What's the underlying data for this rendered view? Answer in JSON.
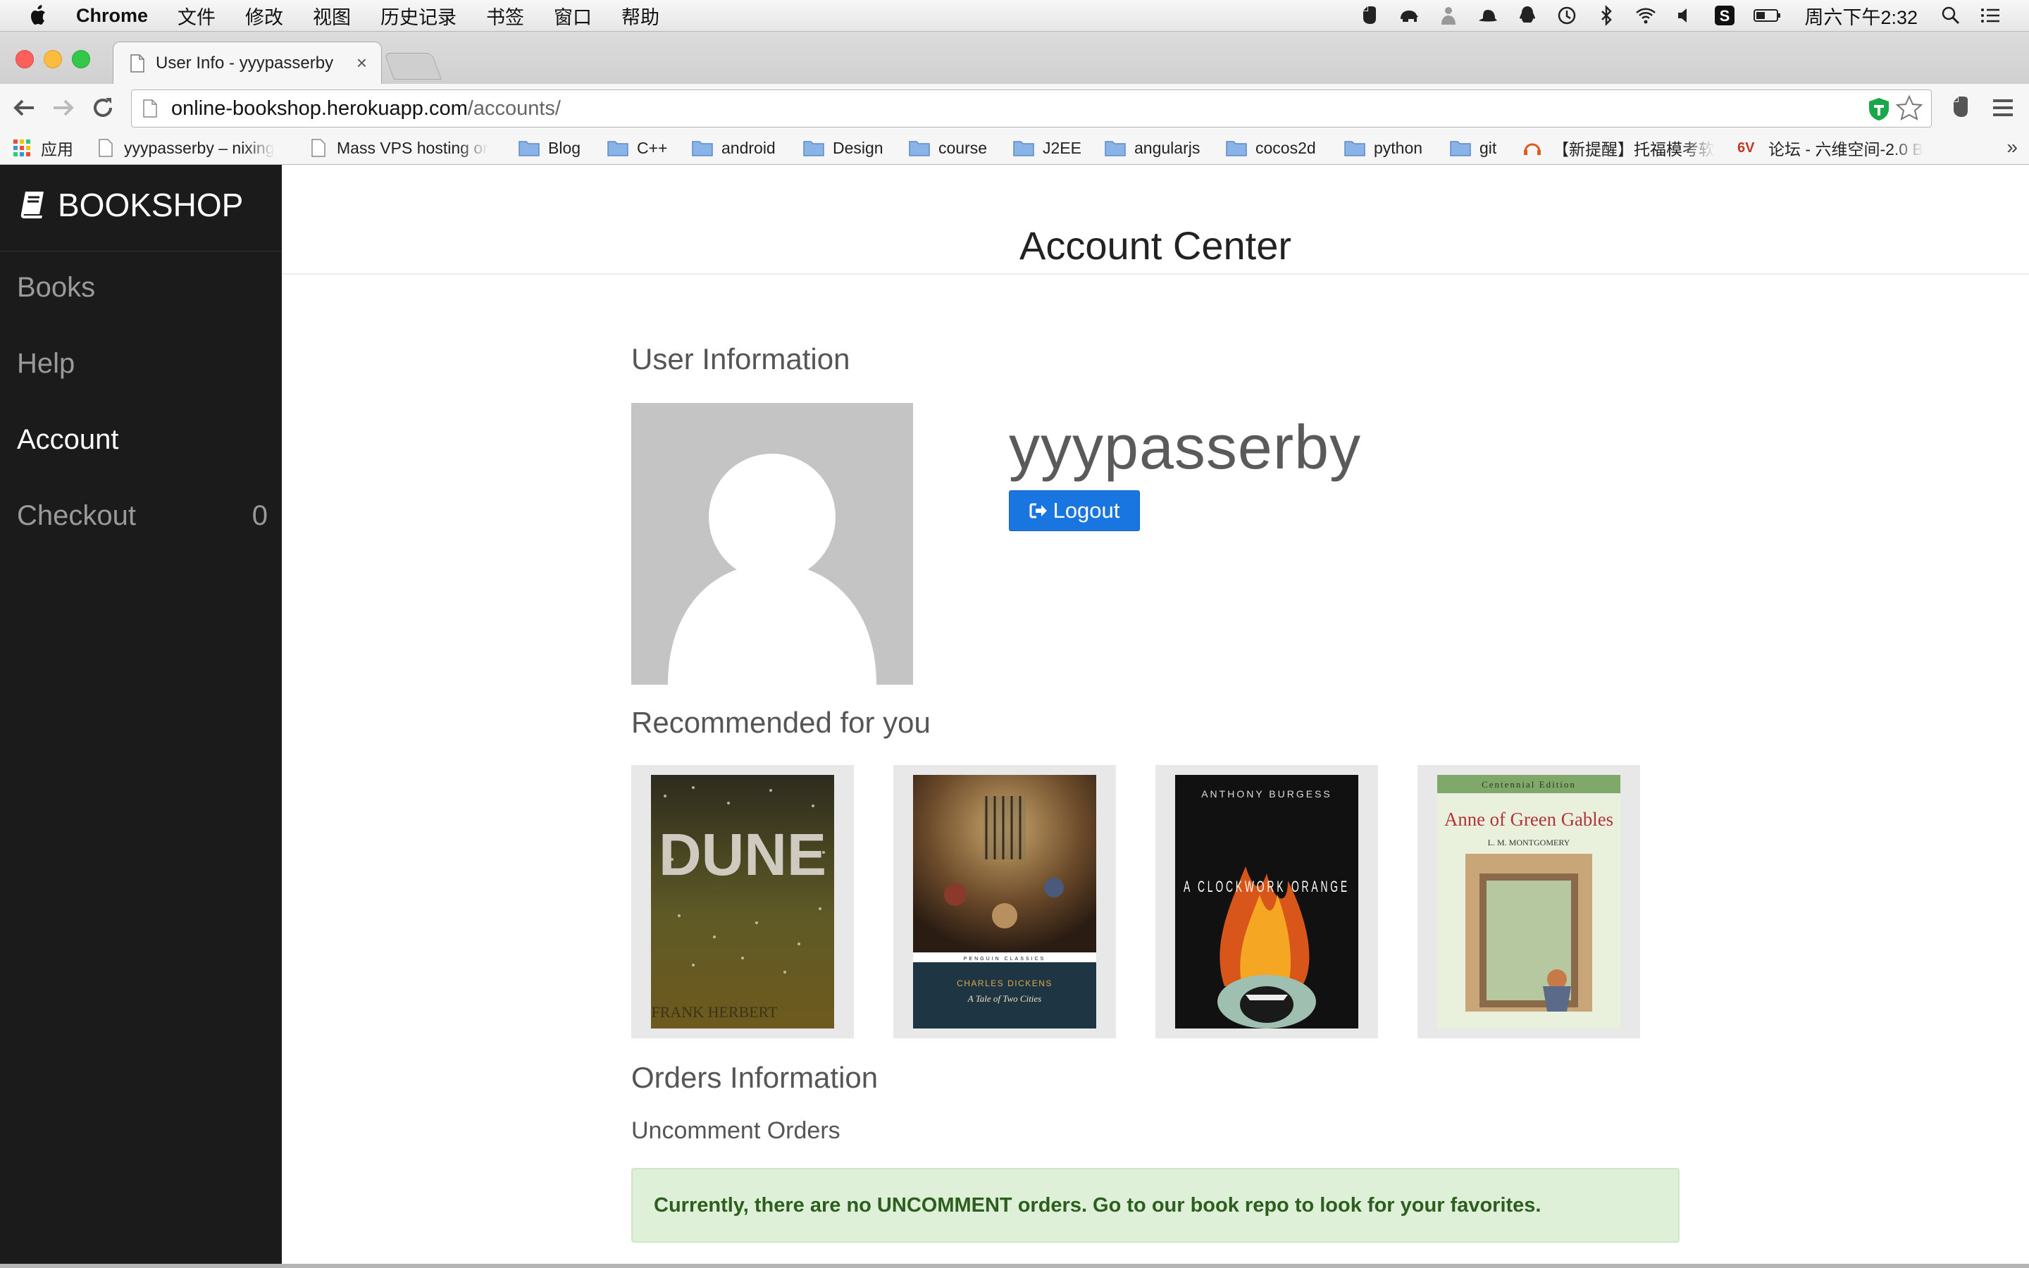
{
  "menubar": {
    "app_name": "Chrome",
    "items": [
      "文件",
      "修改",
      "视图",
      "历史记录",
      "书签",
      "窗口",
      "帮助"
    ],
    "clock": "周六下午2:32"
  },
  "browser": {
    "tab_title": "User Info - yyypasserby",
    "tab_close": "×",
    "url_host": "online-bookshop.herokuapp.com",
    "url_path": "/accounts/"
  },
  "bookmarks": {
    "apps_label": "应用",
    "items": [
      {
        "label": "yyypasserby – nixing",
        "icon": "doc-icon"
      },
      {
        "label": "Mass VPS hosting or",
        "icon": "doc-icon"
      },
      {
        "label": "Blog",
        "icon": "folder-icon"
      },
      {
        "label": "C++",
        "icon": "folder-icon"
      },
      {
        "label": "android",
        "icon": "folder-icon"
      },
      {
        "label": "Design",
        "icon": "folder-icon"
      },
      {
        "label": "course",
        "icon": "folder-icon"
      },
      {
        "label": "J2EE",
        "icon": "folder-icon"
      },
      {
        "label": "angularjs",
        "icon": "folder-icon"
      },
      {
        "label": "cocos2d",
        "icon": "folder-icon"
      },
      {
        "label": "python",
        "icon": "folder-icon"
      },
      {
        "label": "git",
        "icon": "folder-icon"
      },
      {
        "label": "【新提醒】托福模考软",
        "icon": "site-icon"
      },
      {
        "label": "论坛 - 六维空间-2.0 B",
        "icon": "site-icon",
        "icon_text": "6V"
      }
    ],
    "overflow": "»"
  },
  "sidebar": {
    "brand": "BOOKSHOP",
    "items": [
      {
        "label": "Books",
        "active": false
      },
      {
        "label": "Help",
        "active": false
      },
      {
        "label": "Account",
        "active": true
      },
      {
        "label": "Checkout",
        "active": false,
        "badge": "0"
      }
    ]
  },
  "main": {
    "title": "Account Center",
    "user_section": "User Information",
    "username": "yyypasserby",
    "logout_label": "Logout",
    "recommended_heading": "Recommended for you",
    "books": [
      {
        "title": "DUNE",
        "author": "FRANK HERBERT"
      },
      {
        "title": "A Tale of Two Cities",
        "author": "CHARLES DICKENS",
        "series": "PENGUIN CLASSICS"
      },
      {
        "title": "A CLOCKWORK ORANGE",
        "author": "ANTHONY BURGESS"
      },
      {
        "title": "Anne of Green Gables",
        "author": "L. M. MONTGOMERY",
        "edition": "Centennial Edition"
      }
    ],
    "orders_heading": "Orders Information",
    "uncomment_heading": "Uncomment Orders",
    "alert_text": "Currently, there are no UNCOMMENT orders. Go to our book repo to look for your favorites."
  },
  "colors": {
    "sidebar_bg": "#1b1b1b",
    "accent": "#1976e0",
    "alert_bg": "#dff0d8",
    "alert_text": "#2c5e1e",
    "avatar_bg": "#c4c4c4"
  }
}
